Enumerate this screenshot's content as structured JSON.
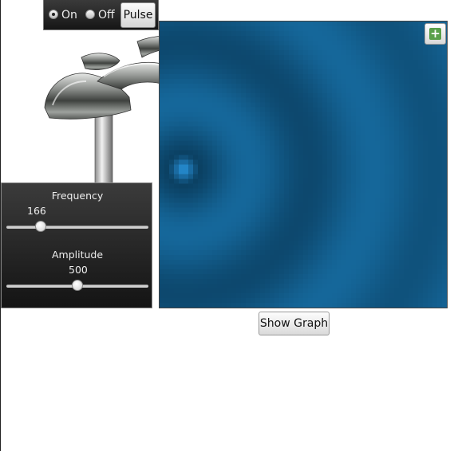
{
  "mode": {
    "options": [
      {
        "label": "On",
        "checked": true
      },
      {
        "label": "Off",
        "checked": false
      }
    ],
    "pulse_label": "Pulse"
  },
  "controls": {
    "frequency": {
      "label": "Frequency",
      "value": "166",
      "fraction": 0.22
    },
    "amplitude": {
      "label": "Amplitude",
      "value": "500",
      "fraction": 0.5
    }
  },
  "show_graph_label": "Show Graph",
  "zoom_button_icon": "plus-icon",
  "colors": {
    "water": "#15679a",
    "water_dark": "#093a5a",
    "source": "#2a9ae6",
    "zoom_green": "#5aa04a",
    "panel_dark": "#1e1e1e"
  }
}
